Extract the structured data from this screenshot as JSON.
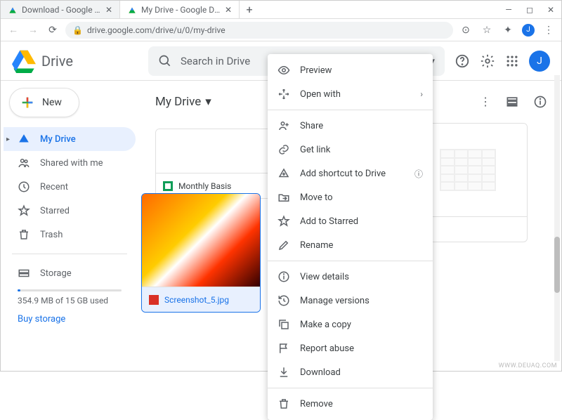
{
  "browser": {
    "tabs": [
      {
        "title": "Download - Google Drive",
        "active": false
      },
      {
        "title": "My Drive - Google Drive",
        "active": true
      }
    ],
    "url": "drive.google.com/drive/u/0/my-drive",
    "avatar_letter": "J"
  },
  "drive": {
    "app_name": "Drive",
    "search_placeholder": "Search in Drive",
    "new_button": "New",
    "avatar_letter": "J",
    "sidebar": [
      {
        "id": "my-drive",
        "label": "My Drive",
        "active": true
      },
      {
        "id": "shared",
        "label": "Shared with me",
        "active": false
      },
      {
        "id": "recent",
        "label": "Recent",
        "active": false
      },
      {
        "id": "starred",
        "label": "Starred",
        "active": false
      },
      {
        "id": "trash",
        "label": "Trash",
        "active": false
      }
    ],
    "storage_label": "Storage",
    "storage_text": "354.9 MB of 15 GB used",
    "buy_storage": "Buy storage",
    "breadcrumb": "My Drive",
    "files": [
      {
        "id": "monthly",
        "name": "Monthly Basis",
        "type": "sheet",
        "selected": false
      },
      {
        "id": "untitled",
        "name": "",
        "type": "sheet",
        "selected": false
      },
      {
        "id": "screenshot",
        "name": "Screenshot_5.jpg",
        "type": "image",
        "selected": true
      }
    ]
  },
  "context_menu": {
    "groups": [
      [
        {
          "id": "preview",
          "label": "Preview",
          "icon": "eye"
        },
        {
          "id": "openwith",
          "label": "Open with",
          "icon": "openwith",
          "chevron": true
        }
      ],
      [
        {
          "id": "share",
          "label": "Share",
          "icon": "person-plus"
        },
        {
          "id": "getlink",
          "label": "Get link",
          "icon": "link"
        },
        {
          "id": "shortcut",
          "label": "Add shortcut to Drive",
          "icon": "drive-add",
          "help": true
        },
        {
          "id": "moveto",
          "label": "Move to",
          "icon": "folder-move"
        },
        {
          "id": "addstar",
          "label": "Add to Starred",
          "icon": "star"
        },
        {
          "id": "rename",
          "label": "Rename",
          "icon": "pencil"
        }
      ],
      [
        {
          "id": "details",
          "label": "View details",
          "icon": "info"
        },
        {
          "id": "versions",
          "label": "Manage versions",
          "icon": "history"
        },
        {
          "id": "copy",
          "label": "Make a copy",
          "icon": "copy"
        },
        {
          "id": "abuse",
          "label": "Report abuse",
          "icon": "flag"
        },
        {
          "id": "download",
          "label": "Download",
          "icon": "download"
        }
      ],
      [
        {
          "id": "remove",
          "label": "Remove",
          "icon": "trash"
        }
      ]
    ]
  },
  "watermark": "WWW.DEUAQ.COM"
}
